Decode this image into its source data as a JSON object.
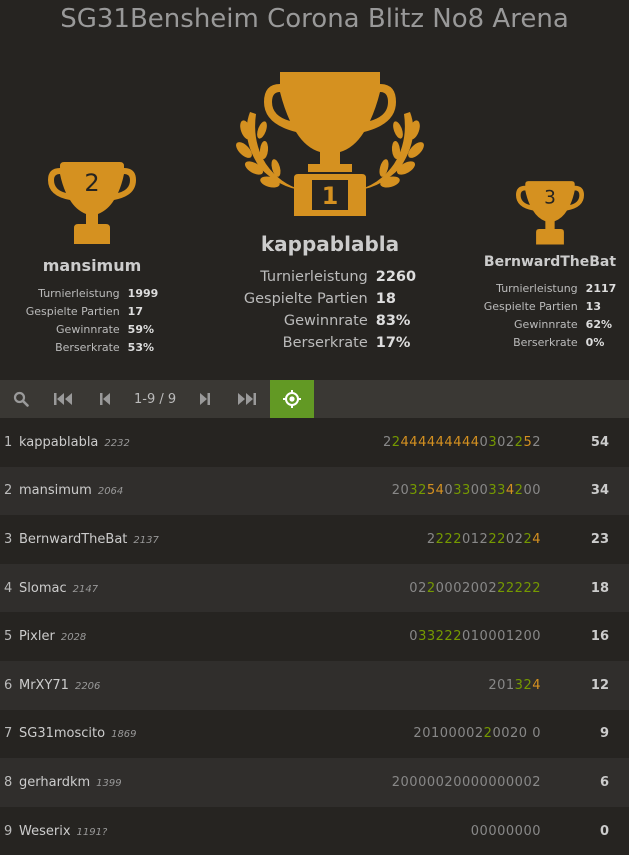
{
  "tournament": {
    "title": "SG31Bensheim Corona Blitz No8 Arena"
  },
  "podium": [
    {
      "place": "2",
      "name": "mansimum",
      "stats": [
        {
          "label": "Turnierleistung",
          "value": "1999"
        },
        {
          "label": "Gespielte Partien",
          "value": "17"
        },
        {
          "label": "Gewinnrate",
          "value": "59%"
        },
        {
          "label": "Berserkrate",
          "value": "53%"
        }
      ]
    },
    {
      "place": "1",
      "name": "kappablabla",
      "stats": [
        {
          "label": "Turnierleistung",
          "value": "2260"
        },
        {
          "label": "Gespielte Partien",
          "value": "18"
        },
        {
          "label": "Gewinnrate",
          "value": "83%"
        },
        {
          "label": "Berserkrate",
          "value": "17%"
        }
      ]
    },
    {
      "place": "3",
      "name": "BernwardTheBat",
      "stats": [
        {
          "label": "Turnierleistung",
          "value": "2117"
        },
        {
          "label": "Gespielte Partien",
          "value": "13"
        },
        {
          "label": "Gewinnrate",
          "value": "62%"
        },
        {
          "label": "Berserkrate",
          "value": "0%"
        }
      ]
    }
  ],
  "toolbar": {
    "search_icon": "search-icon",
    "first_icon": "first-page-icon",
    "prev_icon": "prev-page-icon",
    "pager_text": "1-9 / 9",
    "next_icon": "next-page-icon",
    "last_icon": "last-page-icon",
    "focus_icon": "focus-me-icon",
    "active_color": "#629924"
  },
  "standings": [
    {
      "rank": "1",
      "name": "kappablabla",
      "rating": "2232",
      "sheet": "224444444440302252",
      "total": "54"
    },
    {
      "rank": "2",
      "name": "mansimum",
      "rating": "2064",
      "sheet": "20325403300334200",
      "total": "34"
    },
    {
      "rank": "3",
      "name": "BernwardTheBat",
      "rating": "2137",
      "sheet": "2222012220224",
      "total": "23"
    },
    {
      "rank": "4",
      "name": "Slomac",
      "rating": "2147",
      "sheet": "022000200222222",
      "total": "18"
    },
    {
      "rank": "5",
      "name": "Pixler",
      "rating": "2028",
      "sheet": "033222010001200",
      "total": "16"
    },
    {
      "rank": "6",
      "name": "MrXY71",
      "rating": "2206",
      "sheet": "201324",
      "total": "12"
    },
    {
      "rank": "7",
      "name": "SG31moscito",
      "rating": "1869",
      "sheet": "2010000220020 0",
      "total": "9"
    },
    {
      "rank": "8",
      "name": "gerhardkm",
      "rating": "1399",
      "sheet": "20000020000000002",
      "total": "6"
    },
    {
      "rank": "9",
      "name": "Weserix",
      "rating": "1191?",
      "sheet": "00000000",
      "total": "0"
    }
  ],
  "colors": {
    "background": "#262421",
    "trophy_gold": "#d59120",
    "streak_green": "#759900",
    "streak_orange": "#d59120"
  }
}
